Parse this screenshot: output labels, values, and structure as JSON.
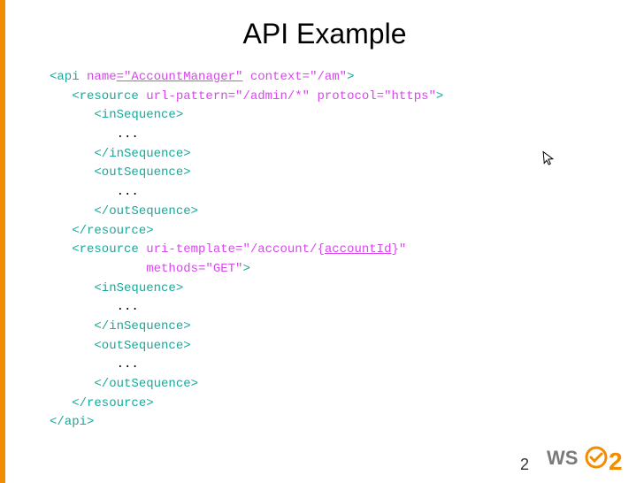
{
  "title": "API Example",
  "code": {
    "l1_open": "<api ",
    "l1_a1": "name",
    "l1_v1": "=\"AccountManager\"",
    "l1_a2": " context",
    "l1_v2": "=\"/am\"",
    "l1_close": ">",
    "l2_open": "   <resource ",
    "l2_a1": "url-pattern",
    "l2_v1": "=\"/admin/*\"",
    "l2_a2": " protocol",
    "l2_v2": "=\"https\"",
    "l2_close": ">",
    "l3": "      <inSequence>",
    "l4": "         ...",
    "l5": "      </inSequence>",
    "l6": "      <outSequence>",
    "l7": "         ...",
    "l8": "      </outSequence>",
    "l9": "   </resource>",
    "l10_open": "   <resource ",
    "l10_a1": "uri-template",
    "l10_v1": "=\"/account/{",
    "l10_v1b": "accountId",
    "l10_v1c": "}\"",
    "l11_pad": "             ",
    "l11_a1": "methods",
    "l11_v1": "=\"GET\"",
    "l11_close": ">",
    "l12": "      <inSequence>",
    "l13": "         ...",
    "l14": "      </inSequence>",
    "l15": "      <outSequence>",
    "l16": "         ...",
    "l17": "      </outSequence>",
    "l18": "   </resource>",
    "l19": "</api>"
  },
  "page_number": "2",
  "logo_text_1": "WS",
  "logo_text_2": "2"
}
